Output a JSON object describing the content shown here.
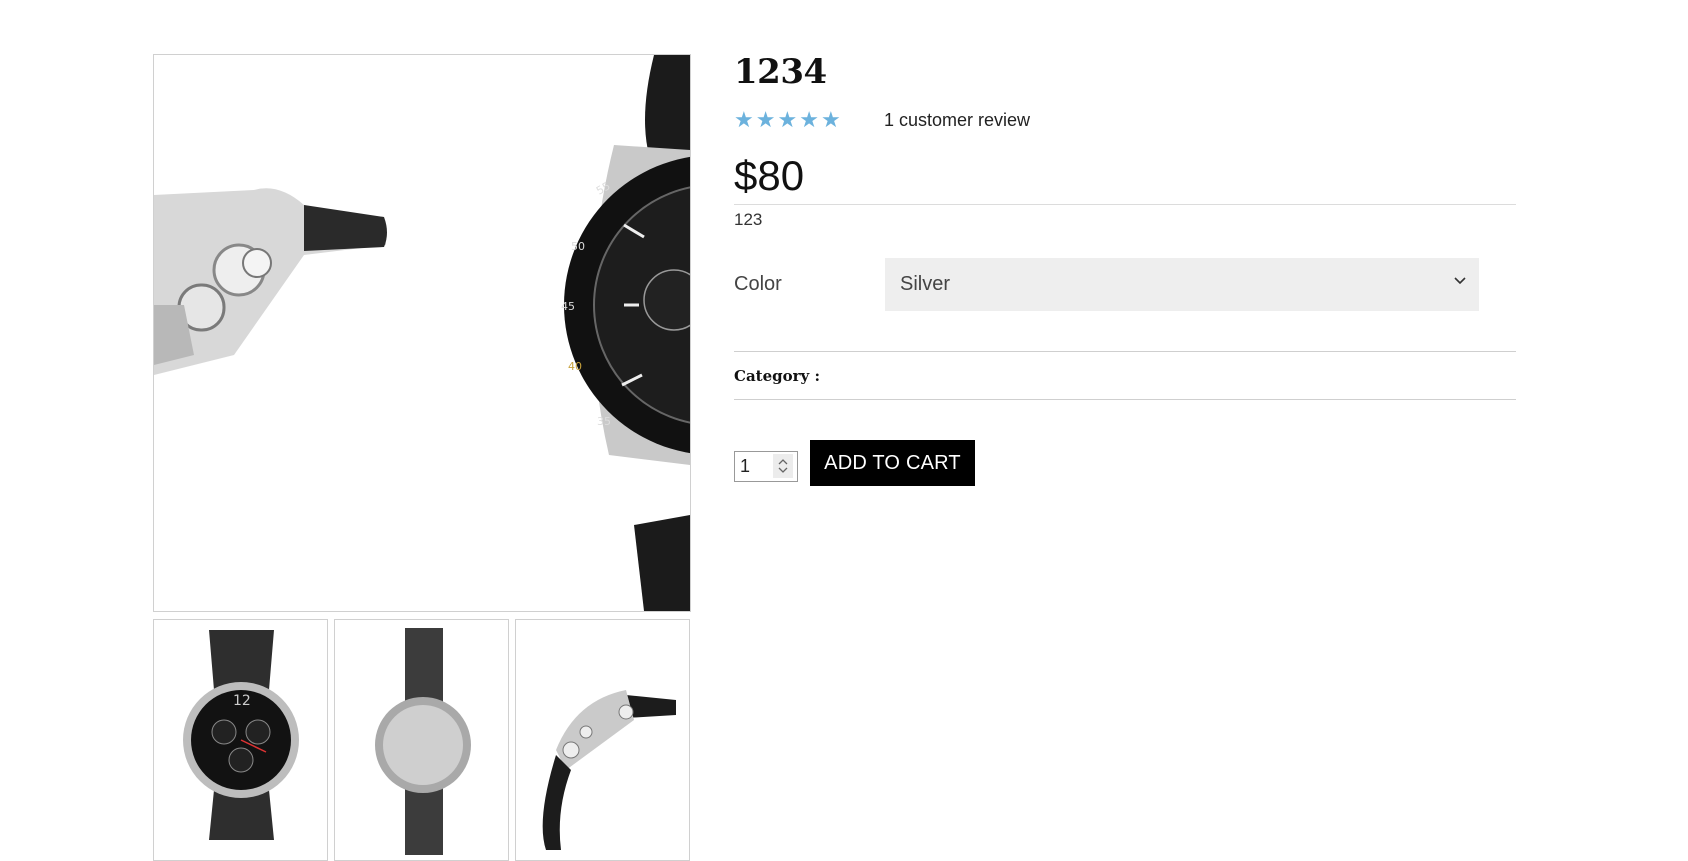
{
  "product": {
    "title": "1234",
    "rating": {
      "stars": 5,
      "max": 5,
      "star_color": "#6cb2dd"
    },
    "review_link": "1 customer review",
    "price": "$80",
    "short_description": "123",
    "variation": {
      "label": "Color",
      "selected": "Silver"
    },
    "meta": {
      "category_label": "Category :"
    },
    "quantity": "1",
    "add_to_cart_label": "ADD TO CART"
  },
  "gallery": {
    "main_image_icon": "watch-side-zoom-image",
    "thumbnails": [
      "watch-front-image",
      "watch-back-image",
      "watch-side-image"
    ]
  }
}
